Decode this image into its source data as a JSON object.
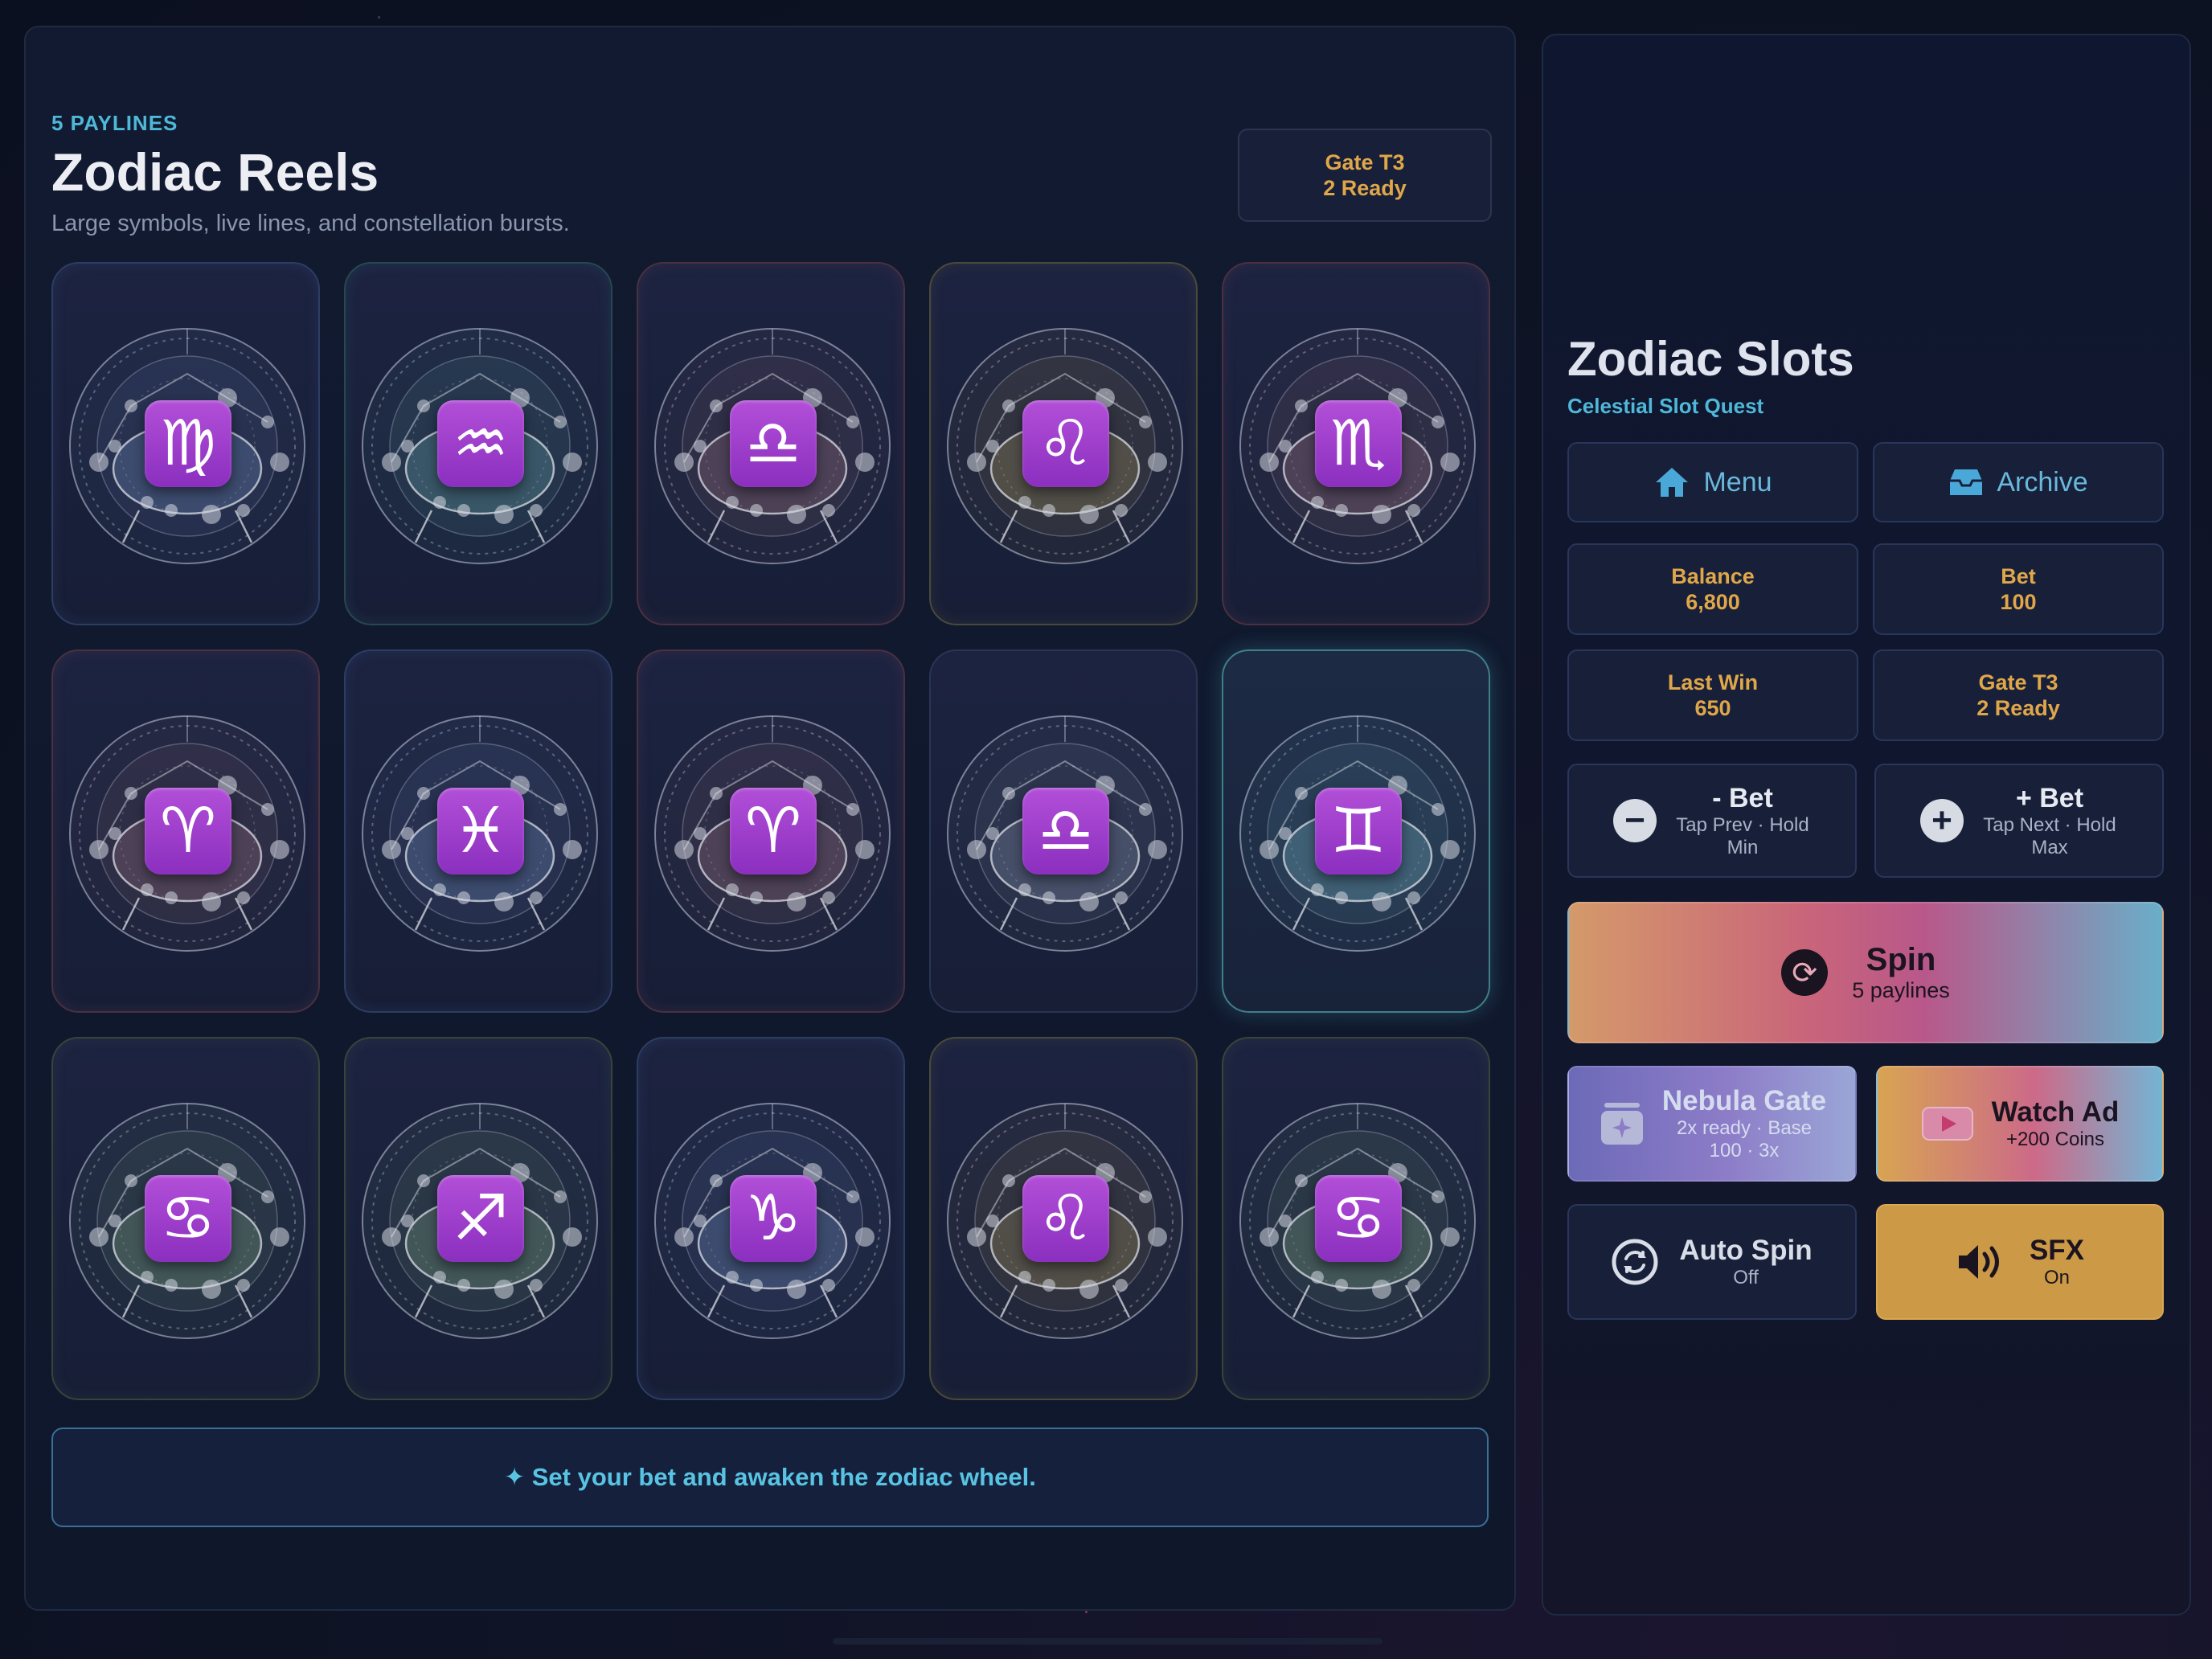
{
  "game": {
    "eyebrow": "5 PAYLINES",
    "title": "Zodiac Reels",
    "subtitle": "Large symbols, live lines, and constellation bursts.",
    "gate_badge": {
      "line1": "Gate T3",
      "line2": "2 Ready"
    },
    "reels": [
      [
        "♍",
        "♒",
        "♎",
        "♌",
        "♏"
      ],
      [
        "♈",
        "♓",
        "♈",
        "♎",
        "♊"
      ],
      [
        "♋",
        "♐",
        "♑",
        "♌",
        "♋"
      ]
    ],
    "message": "✦ Set your bet and awaken the zodiac wheel."
  },
  "sidebar": {
    "title": "Zodiac Slots",
    "subtitle": "Celestial Slot Quest",
    "menu_label": "Menu",
    "archive_label": "Archive",
    "stats": {
      "balance_label": "Balance",
      "balance_value": "6,800",
      "bet_label": "Bet",
      "bet_value": "100",
      "last_win_label": "Last Win",
      "last_win_value": "650",
      "gate_label": "Gate T3",
      "gate_value": "2 Ready"
    },
    "bet_minus": {
      "label": "- Bet",
      "hint": "Tap Prev · Hold Min"
    },
    "bet_plus": {
      "label": "+ Bet",
      "hint": "Tap Next · Hold Max"
    },
    "spin": {
      "label": "Spin",
      "sub": "5 paylines"
    },
    "nebula": {
      "label": "Nebula Gate",
      "sub": "2x ready · Base 100 · 3x"
    },
    "watch_ad": {
      "label": "Watch Ad",
      "sub": "+200 Coins"
    },
    "auto_spin": {
      "label": "Auto Spin",
      "sub": "Off"
    },
    "sfx": {
      "label": "SFX",
      "sub": "On"
    }
  }
}
